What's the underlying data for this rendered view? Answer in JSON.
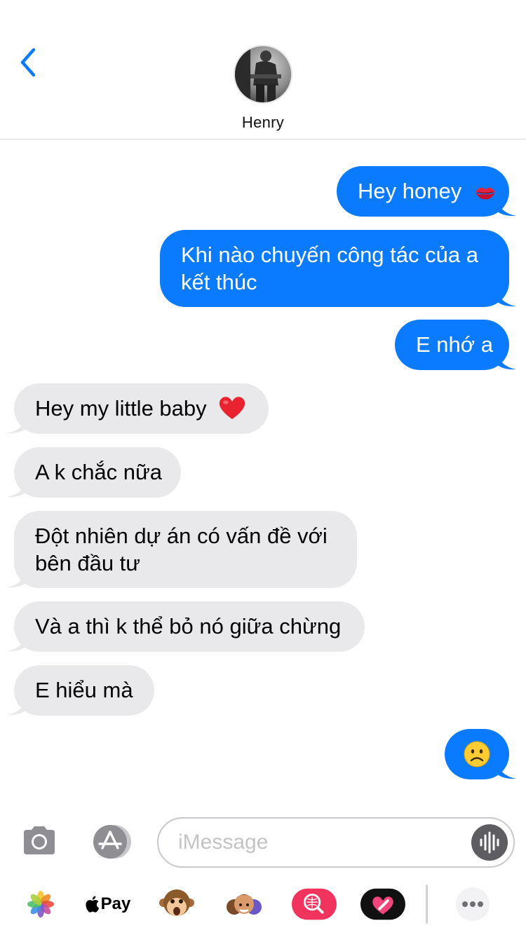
{
  "status_bar": {
    "battery_color": "#f9c812"
  },
  "header": {
    "back_icon": "chevron-left-icon",
    "contact_name": "Henry"
  },
  "messages": [
    {
      "direction": "outgoing",
      "text": "Hey honey",
      "emoji": "kiss-mark"
    },
    {
      "direction": "outgoing",
      "text": "Khi nào chuyến công tác của a kết thúc"
    },
    {
      "direction": "outgoing",
      "text": "E nhớ a"
    },
    {
      "direction": "incoming",
      "text": "Hey my little baby",
      "emoji": "red-heart"
    },
    {
      "direction": "incoming",
      "text": "A k chắc nữa"
    },
    {
      "direction": "incoming",
      "text": "Đột nhiên dự án có vấn đề với bên đầu tư"
    },
    {
      "direction": "incoming",
      "text": "Và a thì k thể bỏ nó giữa chừng"
    },
    {
      "direction": "incoming",
      "text": "E hiểu mà"
    },
    {
      "direction": "outgoing",
      "text": "",
      "emoji": "frowning-face"
    }
  ],
  "input_bar": {
    "placeholder": "iMessage",
    "value": "",
    "camera_icon": "camera-icon",
    "appstore_icon": "app-store-icon",
    "audio_icon": "waveform-icon"
  },
  "app_drawer": {
    "items": [
      {
        "name": "photos-icon"
      },
      {
        "name": "apple-pay",
        "label": "Pay"
      },
      {
        "name": "animoji-monkey-icon"
      },
      {
        "name": "memoji-stickers-icon"
      },
      {
        "name": "web-search-icon"
      },
      {
        "name": "digital-touch-icon"
      },
      {
        "name": "more-icon"
      }
    ]
  },
  "colors": {
    "outgoing_bubble": "#0a7bfe",
    "incoming_bubble": "#e9e9eb",
    "accent": "#0a7bfe"
  }
}
